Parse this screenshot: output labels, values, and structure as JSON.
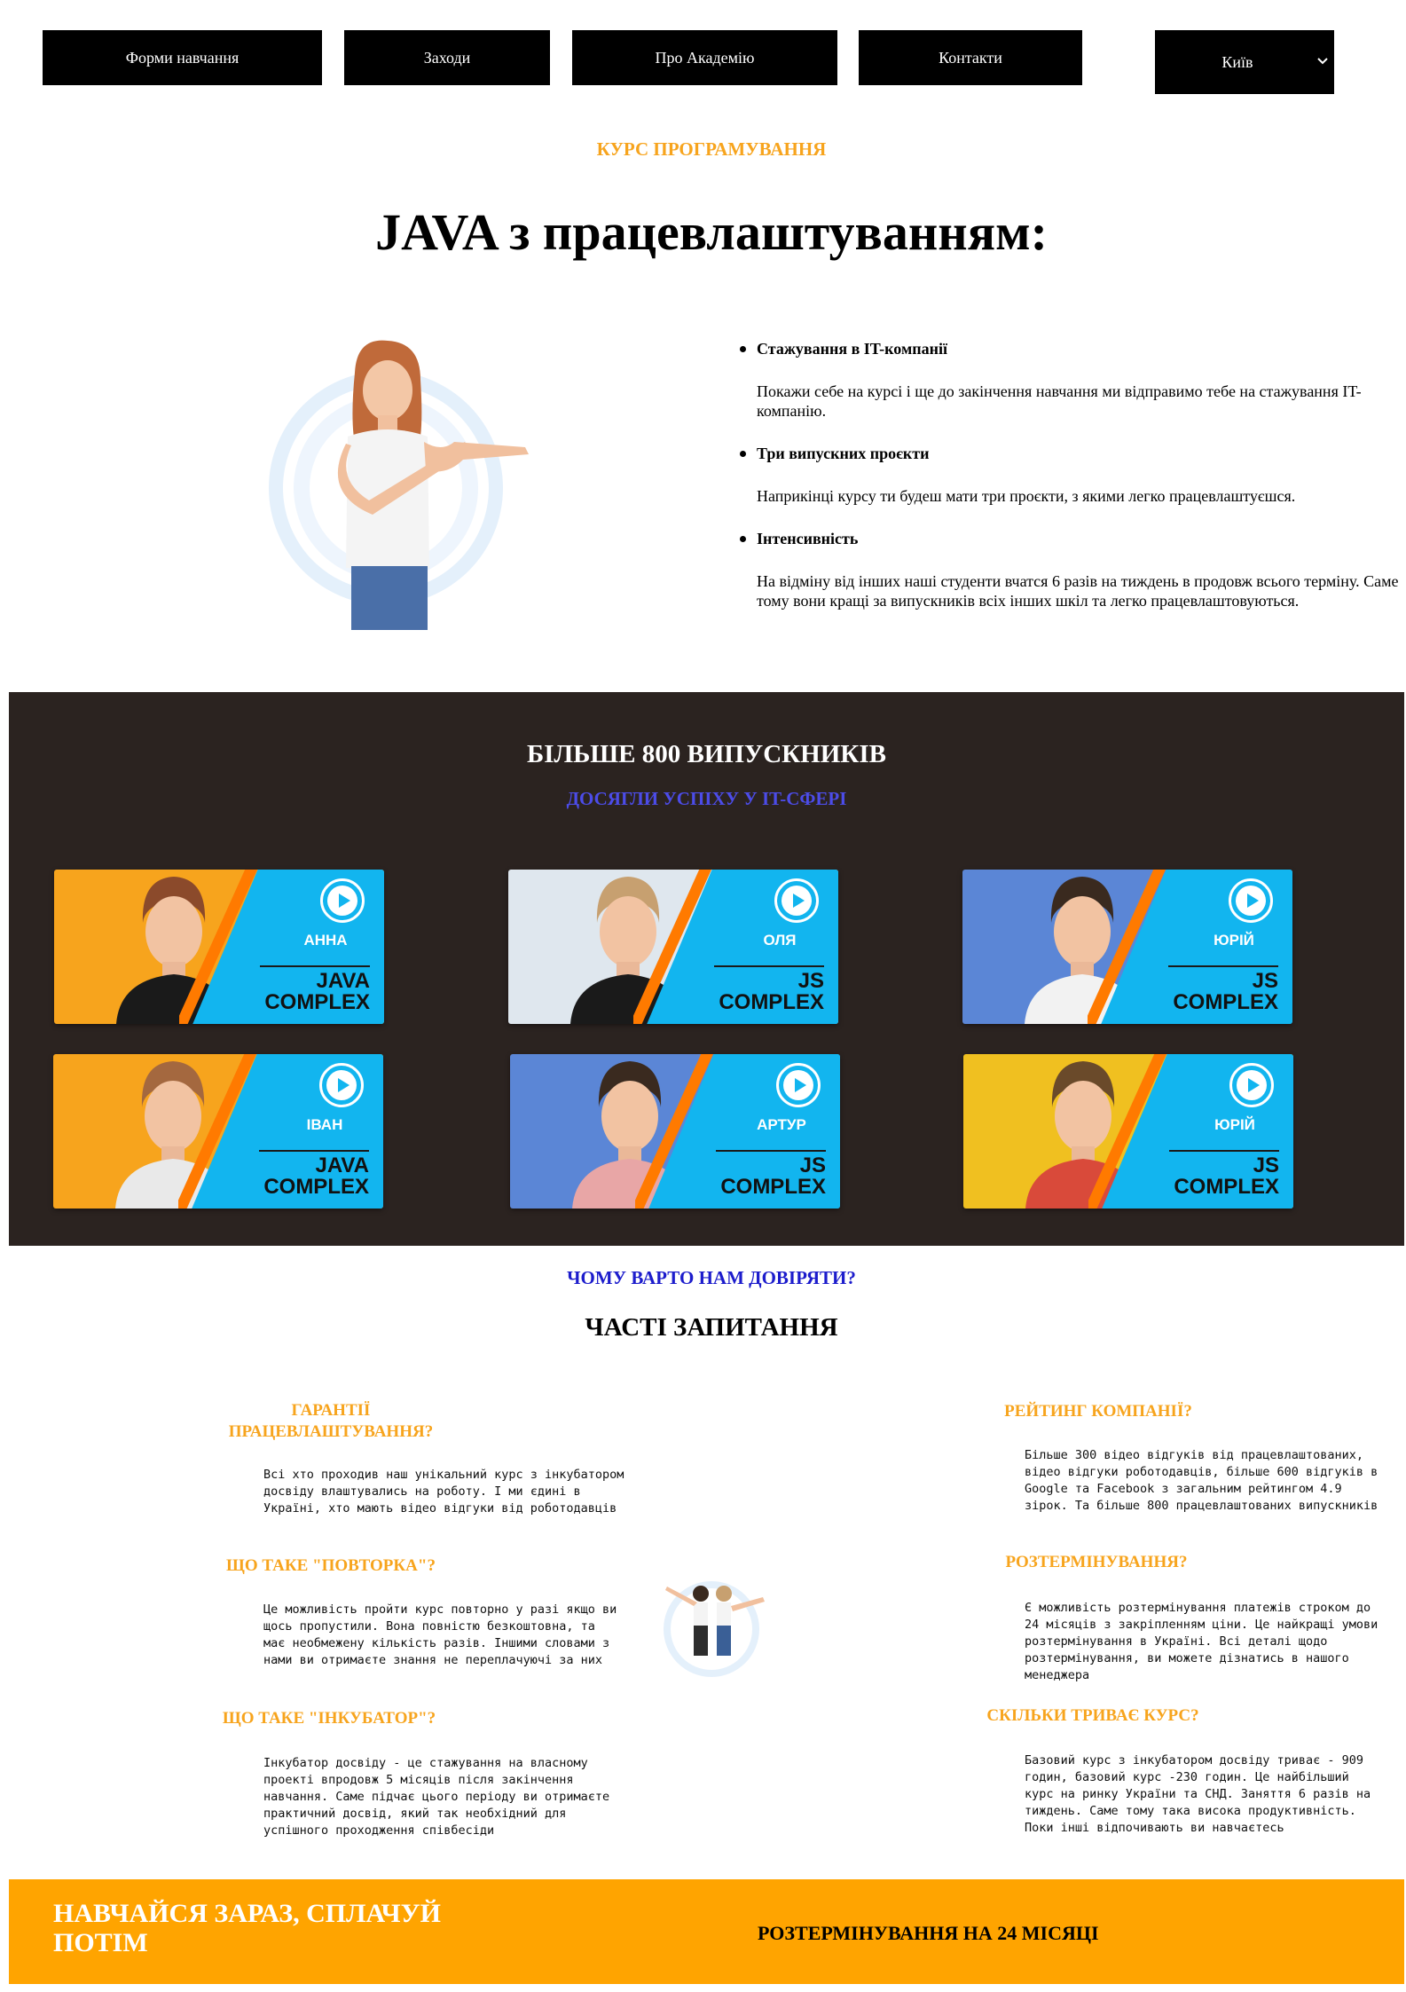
{
  "nav": {
    "items": [
      "Форми навчання",
      "Заходи",
      "Про Академію",
      "Контакти"
    ],
    "city": "Київ"
  },
  "hero": {
    "kicker": "КУРС ПРОГРАМУВАННЯ",
    "title": "JAVA з працевлаштуванням:"
  },
  "features": [
    {
      "title": "Стажування в IT-компанії",
      "text": "Покажи себе на курсі і ще до закінчення навчання ми відправимо тебе на стажування IT-компанію."
    },
    {
      "title": "Три випускних проєкти",
      "text": "Наприкінці курсу ти будеш мати три проєкти, з якими легко працевлаштуєшся."
    },
    {
      "title": "Інтенсивність",
      "text": "На відміну від інших наші студенти вчатся 6 разів на тиждень в продовж всього терміну. Саме тому вони кращі за випускників всіх інших шкіл та легко працевлаштовуються."
    }
  ],
  "graduates": {
    "title": "БІЛЬШЕ 800 ВИПУСКНИКІВ",
    "subtitle": "ДОСЯГЛИ УСПІХУ У IT-СФЕРІ",
    "cards": [
      {
        "name": "АННА",
        "course_line1": "JAVA",
        "course_line2": "COMPLEX",
        "bg": "#f7a41d",
        "shirt": "#1a1a1a",
        "hair": "#8b4a2b"
      },
      {
        "name": "ОЛЯ",
        "course_line1": "JS",
        "course_line2": "COMPLEX",
        "bg": "#dfe7ee",
        "shirt": "#1a1a1a",
        "hair": "#c7a070"
      },
      {
        "name": "ЮРІЙ",
        "course_line1": "JS",
        "course_line2": "COMPLEX",
        "bg": "#5b86d6",
        "shirt": "#f2f2f2",
        "hair": "#3a2a1f"
      },
      {
        "name": "ІВАН",
        "course_line1": "JAVA",
        "course_line2": "COMPLEX",
        "bg": "#f7a41d",
        "shirt": "#e9e9e9",
        "hair": "#a4683f"
      },
      {
        "name": "АРТУР",
        "course_line1": "JS",
        "course_line2": "COMPLEX",
        "bg": "#5b86d6",
        "shirt": "#e8a6a6",
        "hair": "#3a2a1f"
      },
      {
        "name": "ЮРІЙ",
        "course_line1": "JS",
        "course_line2": "COMPLEX",
        "bg": "#f0c020",
        "shirt": "#d94a3a",
        "hair": "#6a4a2a"
      }
    ]
  },
  "faq": {
    "trust_title": "ЧОМУ ВАРТО НАМ ДОВІРЯТИ?",
    "title": "ЧАСТІ ЗАПИТАННЯ",
    "left": [
      {
        "q_line1": "ГАРАНТІЇ",
        "q_line2": "ПРАЦЕВЛАШТУВАННЯ?",
        "a": "Всі хто проходив наш унікальний курс з інкубатором досвіду влаштувались на роботу. І ми єдині в Україні, хто мають відео відгуки від роботодавців"
      },
      {
        "q": "ЩО ТАКЕ \"ПОВТОРКА\"?",
        "a": "Це можливість пройти курс повторно у разі якщо ви щось пропустили. Вона повністю безкоштовна, та має необмежену кількість разів. Іншими словами з нами ви отримаєте знання не переплачуючі за них"
      },
      {
        "q": "ЩО ТАКЕ \"ІНКУБАТОР\"?",
        "a": "Інкубатор досвіду - це стажування на власному проекті впродовж 5 місяців після закінчення навчання. Саме підчає цього періоду ви отримаєте практичний досвід, який так необхідний для успішного проходження співбесіди"
      }
    ],
    "right": [
      {
        "q": "РЕЙТИНГ КОМПАНІЇ?",
        "a": "Більше 300 відео відгуків від працевлаштованих, відео відгуки роботодавців, більше 600 відгуків в Google та Facebook з загальним рейтингом 4.9 зірок. Та більше 800 працевлаштованих випускників"
      },
      {
        "q": "РОЗТЕРМІНУВАННЯ?",
        "a": "Є можливість розтермінування платежів строком до 24 місяців з закріпленням ціни. Це найкращі умови розтермінування в Україні. Всі деталі щодо розтермінування, ви можете дізнатись в нашого менеджера"
      },
      {
        "q": "СКІЛЬКИ ТРИВАЄ КУРС?",
        "a": "Базовий курс з інкубатором досвіду триває - 909 годин, базовий курс -230 годин. Це найбільший курс на ринку України та СНД. Заняття 6 разів на тиждень. Саме тому така висока продуктивність. Поки інші відпочивають ви навчаєтесь"
      }
    ]
  },
  "bottom": {
    "left": "НАВЧАЙСЯ ЗАРАЗ, СПЛАЧУЙ ПОТІМ",
    "right": "РОЗТЕРМІНУВАННЯ НА 24 МІСЯЦІ"
  }
}
